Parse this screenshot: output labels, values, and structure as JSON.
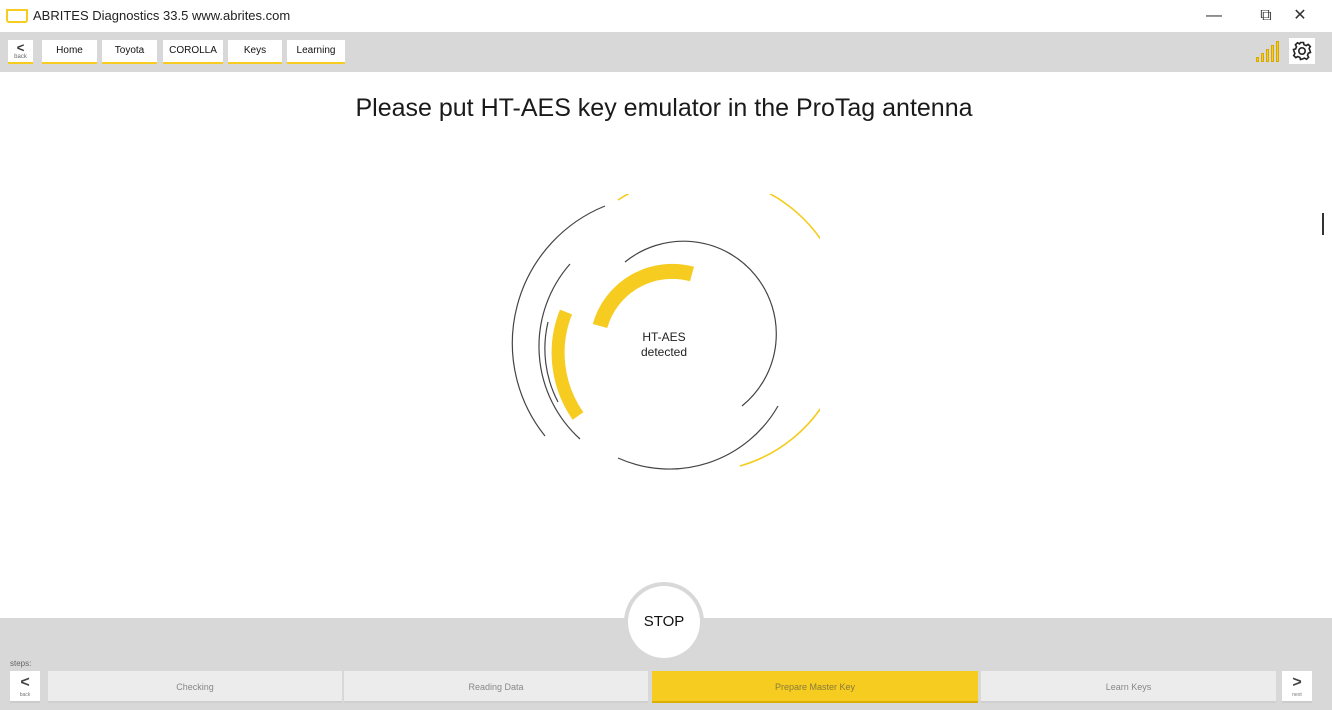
{
  "window": {
    "title": "ABRITES Diagnostics 33.5   www.abrites.com",
    "minimize_glyph": "—",
    "maximize_glyph": "⧉",
    "close_glyph": "✕"
  },
  "toolbar": {
    "back_arrow": "<",
    "back_label": "back",
    "breadcrumbs": [
      "Home",
      "Toyota",
      "COROLLA",
      "Keys",
      "Learning"
    ],
    "signal_icon": "signal-strength-icon",
    "settings_icon": "gear-icon"
  },
  "main": {
    "instruction": "Please put HT-AES key emulator in the ProTag antenna",
    "status_line1": "HT-AES",
    "status_line2": "detected"
  },
  "bottom": {
    "stop_label": "STOP",
    "steps_label": "steps:",
    "back_arrow": "<",
    "back_label": "back",
    "next_arrow": ">",
    "next_label": "next",
    "steps": [
      "Checking",
      "Reading Data",
      "Prepare Master Key",
      "Learn Keys"
    ],
    "active_step": "Prepare Master Key"
  },
  "colors": {
    "accent": "#f5cc1f",
    "toolbar_bg": "#d8d8d8",
    "step_bg": "#ececec"
  }
}
